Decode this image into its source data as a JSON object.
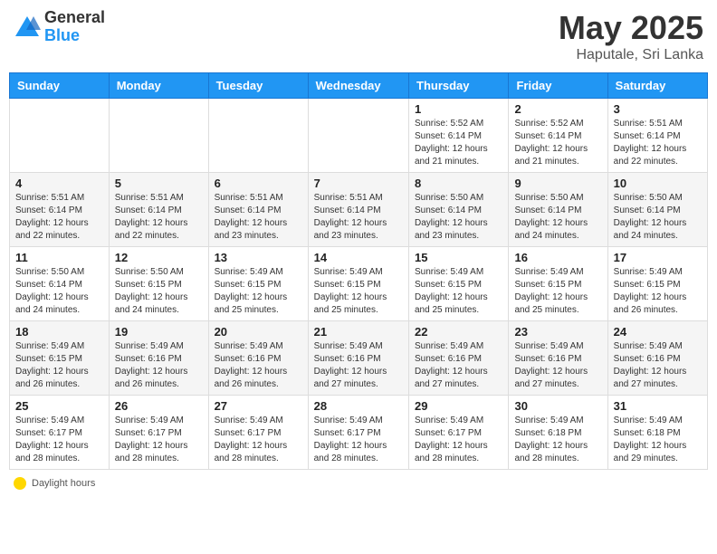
{
  "header": {
    "logo_general": "General",
    "logo_blue": "Blue",
    "month": "May 2025",
    "location": "Haputale, Sri Lanka"
  },
  "footer": {
    "label": "Daylight hours"
  },
  "days_of_week": [
    "Sunday",
    "Monday",
    "Tuesday",
    "Wednesday",
    "Thursday",
    "Friday",
    "Saturday"
  ],
  "weeks": [
    [
      {
        "day": "",
        "info": ""
      },
      {
        "day": "",
        "info": ""
      },
      {
        "day": "",
        "info": ""
      },
      {
        "day": "",
        "info": ""
      },
      {
        "day": "1",
        "info": "Sunrise: 5:52 AM\nSunset: 6:14 PM\nDaylight: 12 hours and 21 minutes."
      },
      {
        "day": "2",
        "info": "Sunrise: 5:52 AM\nSunset: 6:14 PM\nDaylight: 12 hours and 21 minutes."
      },
      {
        "day": "3",
        "info": "Sunrise: 5:51 AM\nSunset: 6:14 PM\nDaylight: 12 hours and 22 minutes."
      }
    ],
    [
      {
        "day": "4",
        "info": "Sunrise: 5:51 AM\nSunset: 6:14 PM\nDaylight: 12 hours and 22 minutes."
      },
      {
        "day": "5",
        "info": "Sunrise: 5:51 AM\nSunset: 6:14 PM\nDaylight: 12 hours and 22 minutes."
      },
      {
        "day": "6",
        "info": "Sunrise: 5:51 AM\nSunset: 6:14 PM\nDaylight: 12 hours and 23 minutes."
      },
      {
        "day": "7",
        "info": "Sunrise: 5:51 AM\nSunset: 6:14 PM\nDaylight: 12 hours and 23 minutes."
      },
      {
        "day": "8",
        "info": "Sunrise: 5:50 AM\nSunset: 6:14 PM\nDaylight: 12 hours and 23 minutes."
      },
      {
        "day": "9",
        "info": "Sunrise: 5:50 AM\nSunset: 6:14 PM\nDaylight: 12 hours and 24 minutes."
      },
      {
        "day": "10",
        "info": "Sunrise: 5:50 AM\nSunset: 6:14 PM\nDaylight: 12 hours and 24 minutes."
      }
    ],
    [
      {
        "day": "11",
        "info": "Sunrise: 5:50 AM\nSunset: 6:14 PM\nDaylight: 12 hours and 24 minutes."
      },
      {
        "day": "12",
        "info": "Sunrise: 5:50 AM\nSunset: 6:15 PM\nDaylight: 12 hours and 24 minutes."
      },
      {
        "day": "13",
        "info": "Sunrise: 5:49 AM\nSunset: 6:15 PM\nDaylight: 12 hours and 25 minutes."
      },
      {
        "day": "14",
        "info": "Sunrise: 5:49 AM\nSunset: 6:15 PM\nDaylight: 12 hours and 25 minutes."
      },
      {
        "day": "15",
        "info": "Sunrise: 5:49 AM\nSunset: 6:15 PM\nDaylight: 12 hours and 25 minutes."
      },
      {
        "day": "16",
        "info": "Sunrise: 5:49 AM\nSunset: 6:15 PM\nDaylight: 12 hours and 25 minutes."
      },
      {
        "day": "17",
        "info": "Sunrise: 5:49 AM\nSunset: 6:15 PM\nDaylight: 12 hours and 26 minutes."
      }
    ],
    [
      {
        "day": "18",
        "info": "Sunrise: 5:49 AM\nSunset: 6:15 PM\nDaylight: 12 hours and 26 minutes."
      },
      {
        "day": "19",
        "info": "Sunrise: 5:49 AM\nSunset: 6:16 PM\nDaylight: 12 hours and 26 minutes."
      },
      {
        "day": "20",
        "info": "Sunrise: 5:49 AM\nSunset: 6:16 PM\nDaylight: 12 hours and 26 minutes."
      },
      {
        "day": "21",
        "info": "Sunrise: 5:49 AM\nSunset: 6:16 PM\nDaylight: 12 hours and 27 minutes."
      },
      {
        "day": "22",
        "info": "Sunrise: 5:49 AM\nSunset: 6:16 PM\nDaylight: 12 hours and 27 minutes."
      },
      {
        "day": "23",
        "info": "Sunrise: 5:49 AM\nSunset: 6:16 PM\nDaylight: 12 hours and 27 minutes."
      },
      {
        "day": "24",
        "info": "Sunrise: 5:49 AM\nSunset: 6:16 PM\nDaylight: 12 hours and 27 minutes."
      }
    ],
    [
      {
        "day": "25",
        "info": "Sunrise: 5:49 AM\nSunset: 6:17 PM\nDaylight: 12 hours and 28 minutes."
      },
      {
        "day": "26",
        "info": "Sunrise: 5:49 AM\nSunset: 6:17 PM\nDaylight: 12 hours and 28 minutes."
      },
      {
        "day": "27",
        "info": "Sunrise: 5:49 AM\nSunset: 6:17 PM\nDaylight: 12 hours and 28 minutes."
      },
      {
        "day": "28",
        "info": "Sunrise: 5:49 AM\nSunset: 6:17 PM\nDaylight: 12 hours and 28 minutes."
      },
      {
        "day": "29",
        "info": "Sunrise: 5:49 AM\nSunset: 6:17 PM\nDaylight: 12 hours and 28 minutes."
      },
      {
        "day": "30",
        "info": "Sunrise: 5:49 AM\nSunset: 6:18 PM\nDaylight: 12 hours and 28 minutes."
      },
      {
        "day": "31",
        "info": "Sunrise: 5:49 AM\nSunset: 6:18 PM\nDaylight: 12 hours and 29 minutes."
      }
    ]
  ]
}
